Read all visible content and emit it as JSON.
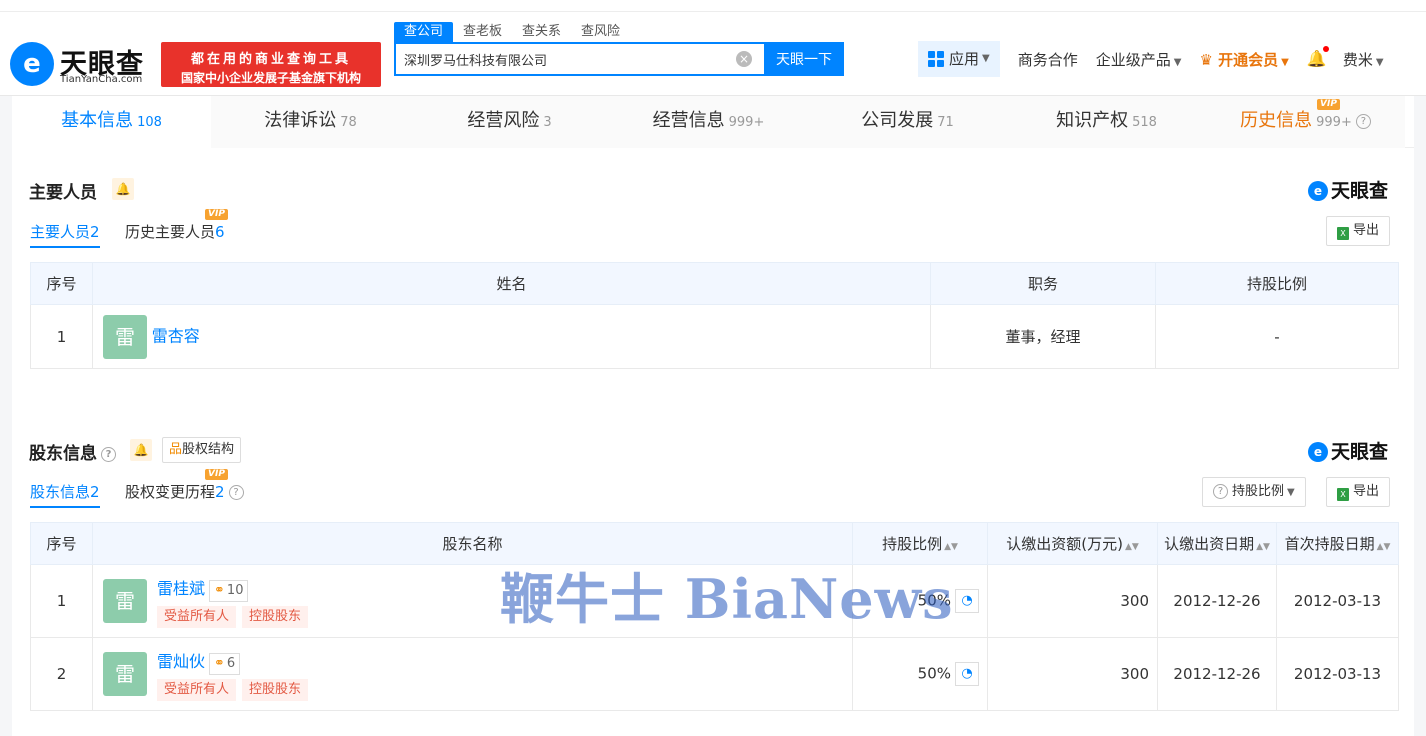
{
  "header": {
    "logo_cn": "天眼查",
    "logo_en": "TianYanCha.com",
    "promo_line1": "都在用的商业查询工具",
    "promo_line2": "国家中小企业发展子基金旗下机构",
    "search_tabs": [
      "查公司",
      "查老板",
      "查关系",
      "查风险"
    ],
    "search_value": "深圳罗马仕科技有限公司",
    "search_button": "天眼一下",
    "apps": "应用",
    "nav": [
      "商务合作",
      "企业级产品"
    ],
    "vip": "开通会员",
    "user": "费米"
  },
  "tabs": [
    {
      "label": "基本信息",
      "count": "108"
    },
    {
      "label": "法律诉讼",
      "count": "78"
    },
    {
      "label": "经营风险",
      "count": "3"
    },
    {
      "label": "经营信息",
      "count": "999+"
    },
    {
      "label": "公司发展",
      "count": "71"
    },
    {
      "label": "知识产权",
      "count": "518"
    },
    {
      "label": "历史信息",
      "count": "999+"
    }
  ],
  "vip_badge": "VIP",
  "brand_small": "天眼查",
  "export": "导出",
  "key_personnel": {
    "title": "主要人员",
    "subtab_current": "主要人员",
    "subtab_current_count": "2",
    "subtab_history": "历史主要人员",
    "subtab_history_count": "6",
    "columns": [
      "序号",
      "姓名",
      "职务",
      "持股比例"
    ],
    "rows": [
      {
        "index": "1",
        "avatar": "雷",
        "name": "雷杏容",
        "position": "董事，经理",
        "share": "-"
      }
    ]
  },
  "shareholders": {
    "title": "股东信息",
    "structure_button": "股权结构",
    "subtab_current": "股东信息",
    "subtab_current_count": "2",
    "subtab_history": "股权变更历程",
    "subtab_history_count": "2",
    "sort_button": "持股比例",
    "columns": [
      "序号",
      "股东名称",
      "持股比例",
      "认缴出资额(万元)",
      "认缴出资日期",
      "首次持股日期"
    ],
    "rows": [
      {
        "index": "1",
        "avatar": "雷",
        "name": "雷桂斌",
        "relations": "10",
        "tags": [
          "受益所有人",
          "控股股东"
        ],
        "share": "50%",
        "amount": "300",
        "subscribe_date": "2012-12-26",
        "first_date": "2012-03-13"
      },
      {
        "index": "2",
        "avatar": "雷",
        "name": "雷灿伙",
        "relations": "6",
        "tags": [
          "受益所有人",
          "控股股东"
        ],
        "share": "50%",
        "amount": "300",
        "subscribe_date": "2012-12-26",
        "first_date": "2012-03-13"
      }
    ]
  },
  "watermark": "鞭牛士 BiaNews"
}
